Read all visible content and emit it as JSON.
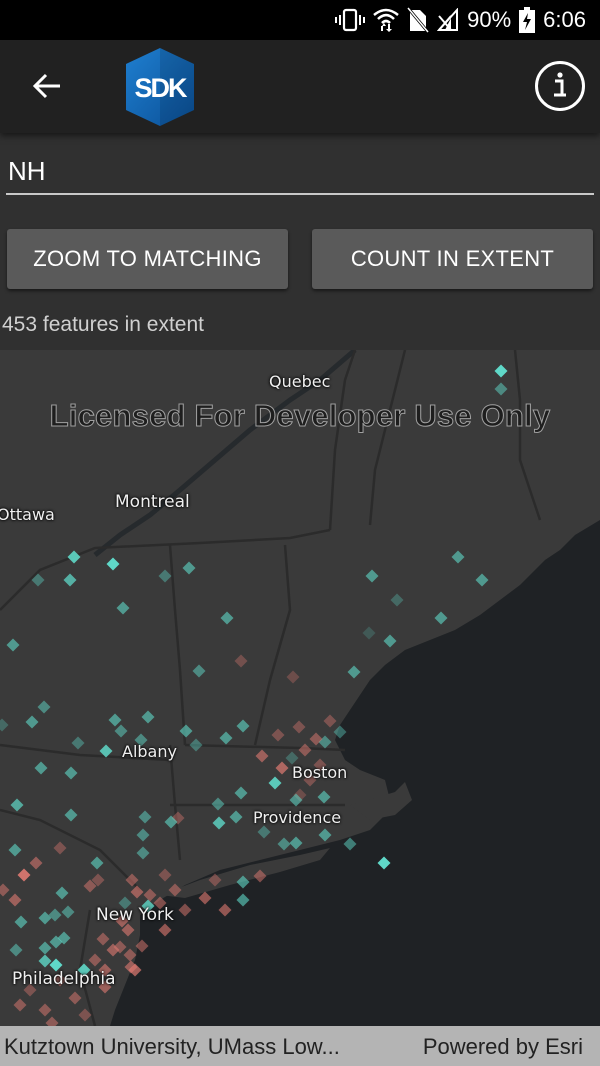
{
  "status_bar": {
    "battery_percent": "90%",
    "time": "6:06",
    "icons": [
      "vibrate-icon",
      "wifi-icon",
      "no-sim-icon",
      "no-signal-icon",
      "battery-charging-icon"
    ]
  },
  "app_bar": {
    "back_icon": "arrow-left-icon",
    "logo_text": "SDK",
    "info_icon": "info-icon"
  },
  "query": {
    "input_value": "NH",
    "placeholder": ""
  },
  "buttons": {
    "zoom_to_matching": "ZOOM TO MATCHING",
    "count_in_extent": "COUNT IN EXTENT"
  },
  "result": {
    "count_text": "453 features in extent"
  },
  "map": {
    "watermark": "Licensed For Developer Use Only",
    "cities": [
      {
        "name": "Quebec"
      },
      {
        "name": "Montreal"
      },
      {
        "name": "Ottawa"
      },
      {
        "name": "Albany"
      },
      {
        "name": "Boston"
      },
      {
        "name": "Providence"
      },
      {
        "name": "New York"
      },
      {
        "name": "Philadelphia"
      }
    ],
    "colors": {
      "land": "#3a3a3a",
      "water": "#1f2225",
      "match_marker": "#5fd8c8",
      "nonmatch_marker": "#e07a72"
    }
  },
  "attribution": {
    "sources": "Kutztown University, UMass Low...",
    "powered_by": "Powered by Esri"
  }
}
